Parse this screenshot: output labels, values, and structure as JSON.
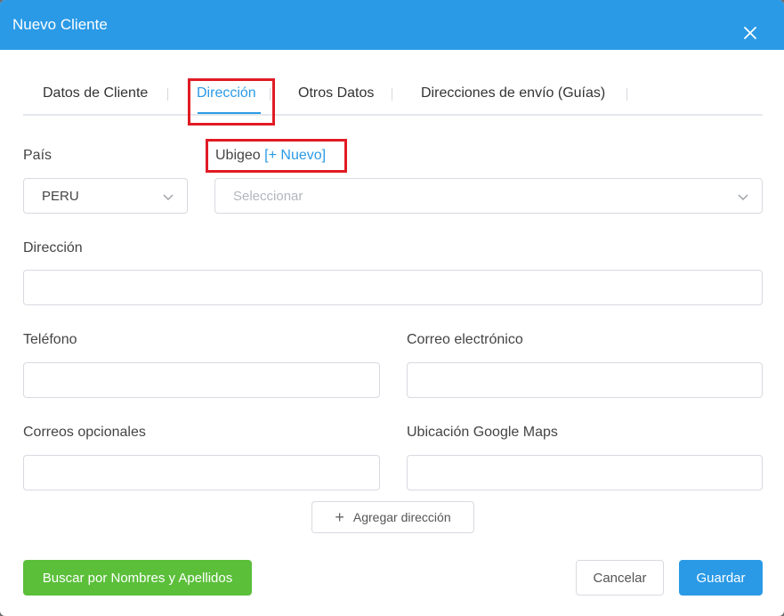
{
  "dialog": {
    "title": "Nuevo Cliente",
    "close_icon": "close-icon"
  },
  "tabs": [
    {
      "label": "Datos de Cliente",
      "active": false
    },
    {
      "label": "Dirección",
      "active": true
    },
    {
      "label": "Otros Datos",
      "active": false
    },
    {
      "label": "Direcciones de envío (Guías)",
      "active": false
    }
  ],
  "form": {
    "country_label": "País",
    "country_value": "PERU",
    "ubigeo_label": "Ubigeo",
    "ubigeo_link": "[+ Nuevo]",
    "ubigeo_placeholder": "Seleccionar",
    "address_label": "Dirección",
    "address_value": "",
    "phone_label": "Teléfono",
    "phone_value": "",
    "email_label": "Correo electrónico",
    "email_value": "",
    "optional_emails_label": "Correos opcionales",
    "optional_emails_value": "",
    "maps_label": "Ubicación Google Maps",
    "maps_value": ""
  },
  "actions": {
    "add_address": "Agregar dirección",
    "search_names": "Buscar por Nombres y Apellidos",
    "cancel": "Cancelar",
    "save": "Guardar"
  },
  "colors": {
    "primary": "#2a9ae6",
    "success": "#5bbf3a",
    "highlight": "#e01b24"
  }
}
